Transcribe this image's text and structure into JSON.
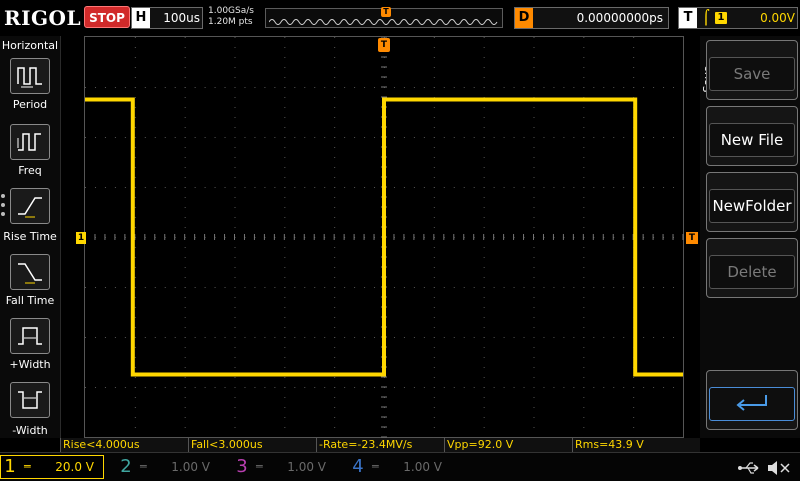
{
  "header": {
    "brand": "RIGOL",
    "run_state": "STOP",
    "horizontal": {
      "label": "H",
      "timebase": "100us"
    },
    "sample_rate": "1.00GSa/s",
    "memory_depth": "1.20M pts",
    "delay": {
      "label": "D",
      "value": "0.00000000ps"
    },
    "trigger": {
      "label": "T",
      "edge_icon": "rising-edge-icon",
      "source": "1",
      "level": "0.00V"
    }
  },
  "left_menu": {
    "title": "Horizontal",
    "items": [
      {
        "label": "Period",
        "icon": "period-icon"
      },
      {
        "label": "Freq",
        "icon": "frequency-icon"
      },
      {
        "label": "Rise Time",
        "icon": "rise-time-icon"
      },
      {
        "label": "Fall Time",
        "icon": "fall-time-icon"
      },
      {
        "label": "+Width",
        "icon": "positive-width-icon"
      },
      {
        "label": "-Width",
        "icon": "negative-width-icon"
      }
    ]
  },
  "right_menu": {
    "title": "Save",
    "items": [
      {
        "label": "Save",
        "enabled": false
      },
      {
        "label": "New File",
        "enabled": true
      },
      {
        "label": "NewFolder",
        "enabled": true
      },
      {
        "label": "Delete",
        "enabled": false
      },
      {
        "label": "",
        "icon": "return-arrow-icon",
        "enabled": true
      }
    ]
  },
  "markers": {
    "trigger_position": "T",
    "ch1_ground": "1",
    "trigger_level": "T"
  },
  "measurements": [
    {
      "text": "Rise<4.000us"
    },
    {
      "text": "Fall<3.000us"
    },
    {
      "text": "-Rate=-23.4MV/s"
    },
    {
      "text": "Vpp=92.0 V"
    },
    {
      "text": "Rms=43.9 V"
    }
  ],
  "channels": [
    {
      "num": "1",
      "coupling": "═",
      "scale": "20.0 V",
      "active": true,
      "color": "#ffd700"
    },
    {
      "num": "2",
      "coupling": "═",
      "scale": "1.00 V",
      "active": false,
      "color": "#3fa6a0"
    },
    {
      "num": "3",
      "coupling": "═",
      "scale": "1.00 V",
      "active": false,
      "color": "#b93fb0"
    },
    {
      "num": "4",
      "coupling": "═",
      "scale": "1.00 V",
      "active": false,
      "color": "#3a74c8"
    }
  ],
  "status_icons": [
    "usb-icon",
    "speaker-muted-icon"
  ],
  "waveform": {
    "channel": "1",
    "type": "square",
    "color": "#ffd700",
    "points": [
      [
        0,
        1
      ],
      [
        0.08,
        1
      ],
      [
        0.08,
        -1
      ],
      [
        0.5,
        -1
      ],
      [
        0.5,
        1
      ],
      [
        0.92,
        1
      ],
      [
        0.92,
        -1
      ],
      [
        1,
        -1
      ]
    ]
  }
}
